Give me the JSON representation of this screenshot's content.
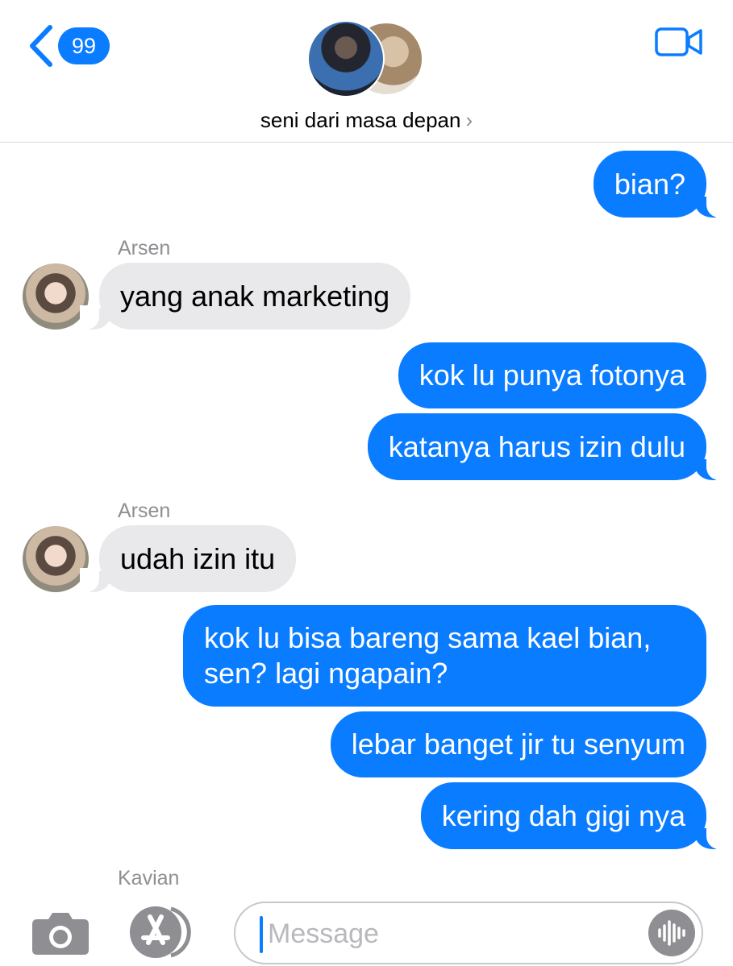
{
  "header": {
    "back_count": "99",
    "group_name": "seni dari masa depan",
    "chevron": "›",
    "colors": {
      "accent": "#0a7cff"
    }
  },
  "messages": [
    {
      "sender": "me",
      "text": "bian?"
    },
    {
      "sender_name": "Arsen",
      "text": "yang anak marketing"
    },
    {
      "sender": "me",
      "text": "kok lu punya fotonya"
    },
    {
      "sender": "me",
      "text": "katanya harus izin dulu"
    },
    {
      "sender_name": "Arsen",
      "text": "udah izin itu"
    },
    {
      "sender": "me",
      "lines": [
        "kok lu bisa bareng sama kael bian,",
        "sen? lagi ngapain?"
      ]
    },
    {
      "sender": "me",
      "text": "lebar banget jir tu senyum"
    },
    {
      "sender": "me",
      "text": "kering dah gigi nya"
    }
  ],
  "typing_indicator_name": "Kavian",
  "composer": {
    "placeholder": "Message",
    "icons": [
      "camera-icon",
      "app-store-icon",
      "audio-waveform-icon"
    ]
  },
  "colors": {
    "outgoing_bubble": "#0a7cff",
    "incoming_bubble": "#e9e9eb",
    "meta_text": "#8e8e93"
  }
}
